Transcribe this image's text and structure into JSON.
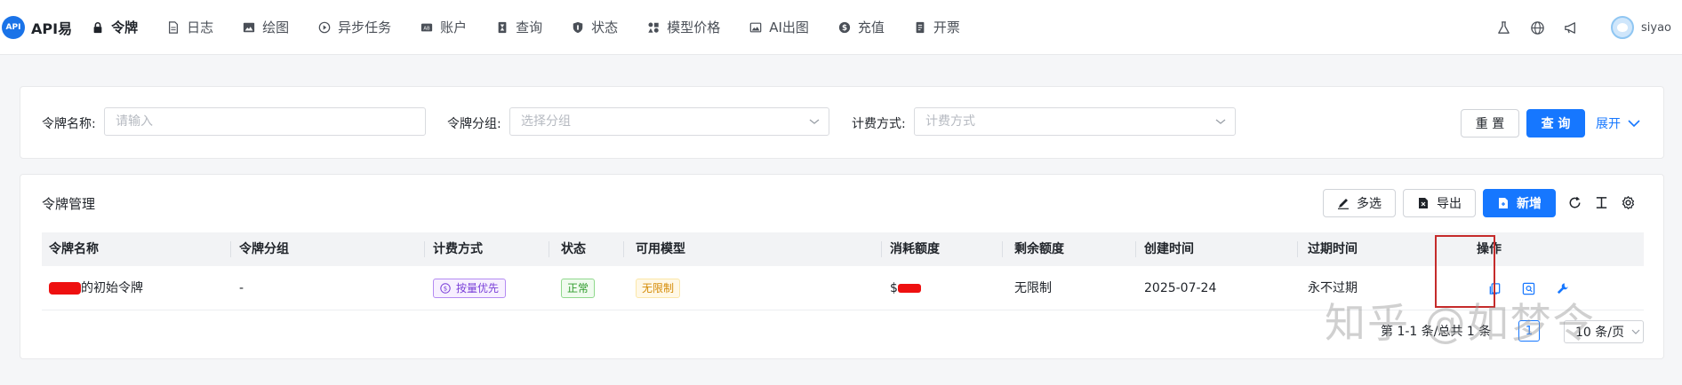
{
  "app": {
    "logo_badge": "API",
    "logo_text": "API易"
  },
  "nav": {
    "items": [
      {
        "label": "令牌",
        "icon": "lock-icon",
        "active": true
      },
      {
        "label": "日志",
        "icon": "document-icon"
      },
      {
        "label": "绘图",
        "icon": "image-icon"
      },
      {
        "label": "异步任务",
        "icon": "play-circle-icon"
      },
      {
        "label": "账户",
        "icon": "account-icon"
      },
      {
        "label": "查询",
        "icon": "hourglass-icon"
      },
      {
        "label": "状态",
        "icon": "shield-icon"
      },
      {
        "label": "模型价格",
        "icon": "shapes-icon"
      },
      {
        "label": "AI出图",
        "icon": "picture-icon"
      },
      {
        "label": "充值",
        "icon": "dollar-circle-icon"
      },
      {
        "label": "开票",
        "icon": "receipt-icon"
      }
    ],
    "right_icons": [
      "flask-icon",
      "globe-icon",
      "megaphone-icon"
    ],
    "username": "siyao"
  },
  "search": {
    "name_label": "令牌名称:",
    "name_placeholder": "请输入",
    "group_label": "令牌分组:",
    "group_placeholder": "选择分组",
    "billing_label": "计费方式:",
    "billing_placeholder": "计费方式",
    "reset_label": "重 置",
    "query_label": "查 询",
    "expand_label": "展开"
  },
  "table_panel": {
    "title": "令牌管理",
    "multi_select_label": "多选",
    "export_label": "导出",
    "add_label": "新增",
    "columns": [
      "令牌名称",
      "令牌分组",
      "计费方式",
      "状态",
      "可用模型",
      "消耗额度",
      "剩余额度",
      "创建时间",
      "过期时间",
      "操作"
    ],
    "rows": [
      {
        "name_suffix": "的初始令牌",
        "group": "-",
        "billing": "按量优先",
        "status": "正常",
        "models": "无限制",
        "used_prefix": "$",
        "remaining": "无限制",
        "created": "2025-07-24",
        "expires": "永不过期"
      }
    ],
    "colors": {
      "primary": "#1677ff",
      "billing_tag": "#7a3fd8",
      "status_tag": "#2e9b2b",
      "models_tag": "#d48a05",
      "highlight": "#c52b2b"
    }
  },
  "pagination": {
    "summary": "第 1-1 条/总共 1 条",
    "current_page": "1",
    "page_size": "10 条/页"
  },
  "watermark": "知乎 @如梦令"
}
